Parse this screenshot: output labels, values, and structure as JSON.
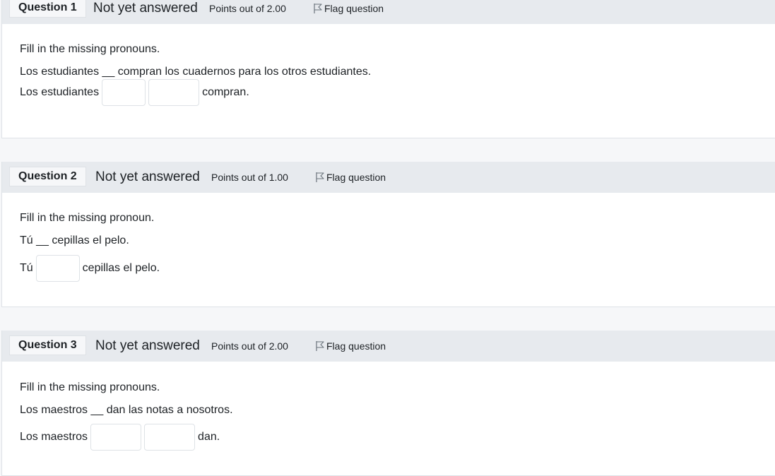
{
  "questions": [
    {
      "number_label": "Question 1",
      "status": "Not yet answered",
      "points": "Points out of 2.00",
      "flag_label": "Flag question",
      "instruction": "Fill in the missing pronouns.",
      "sentence": "Los estudiantes __ compran los cuadernos para los otros estudiantes.",
      "answer_prefix": "Los estudiantes",
      "answer_suffix": "compran.",
      "answer_values": [
        "",
        ""
      ]
    },
    {
      "number_label": "Question 2",
      "status": "Not yet answered",
      "points": "Points out of 1.00",
      "flag_label": "Flag question",
      "instruction": "Fill in the missing pronoun.",
      "sentence": "Tú __ cepillas el pelo.",
      "answer_prefix": "Tú",
      "answer_suffix": "cepillas el pelo.",
      "answer_values": [
        ""
      ]
    },
    {
      "number_label": "Question 3",
      "status": "Not yet answered",
      "points": "Points out of 2.00",
      "flag_label": "Flag question",
      "instruction": "Fill in the missing pronouns.",
      "sentence": "Los maestros __ dan las notas a nosotros.",
      "answer_prefix": "Los maestros",
      "answer_suffix": "dan.",
      "answer_values": [
        "",
        ""
      ]
    }
  ],
  "icons": {
    "flag": "flag-icon"
  },
  "colors": {
    "header_bg": "#e7eaee",
    "page_bg": "#f6f7f9",
    "body_bg": "#ffffff",
    "border": "#dee2e6",
    "text": "#1d2125"
  }
}
